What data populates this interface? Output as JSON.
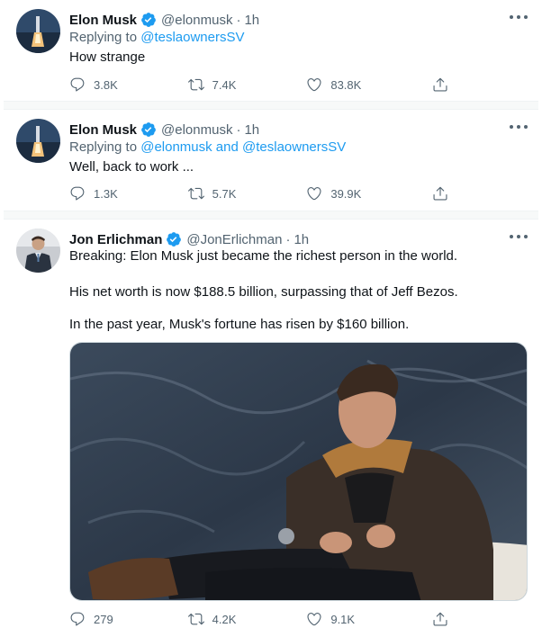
{
  "tweets": [
    {
      "author": "Elon Musk",
      "handle": "@elonmusk",
      "sep": "·",
      "time": "1h",
      "replying_prefix": "Replying to",
      "replying_to": "@teslaownersSV",
      "text": "How strange",
      "replies": "3.8K",
      "retweets": "7.4K",
      "likes": "83.8K",
      "avatar_icon": "rocket-launch-avatar"
    },
    {
      "author": "Elon Musk",
      "handle": "@elonmusk",
      "sep": "·",
      "time": "1h",
      "replying_prefix": "Replying to",
      "replying_to": "@elonmusk and @teslaownersSV",
      "text": "Well, back to work ...",
      "replies": "1.3K",
      "retweets": "5.7K",
      "likes": "39.9K",
      "avatar_icon": "rocket-launch-avatar"
    },
    {
      "author": "Jon Erlichman",
      "handle": "@JonErlichman",
      "sep": "·",
      "time": "1h",
      "text_lines": [
        "Breaking: Elon Musk just became the richest person in the world.",
        "His net worth is now $188.5 billion, surpassing that of Jeff Bezos.",
        "In the past year, Musk's fortune has risen by $160 billion."
      ],
      "replies": "279",
      "retweets": "4.2K",
      "likes": "9.1K",
      "avatar_icon": "person-suit-avatar",
      "media_icon": "man-in-leather-jacket-photo"
    }
  ],
  "colors": {
    "accent": "#1d9bf0",
    "secondary_text": "#536471",
    "separator": "#f7f9f9"
  }
}
